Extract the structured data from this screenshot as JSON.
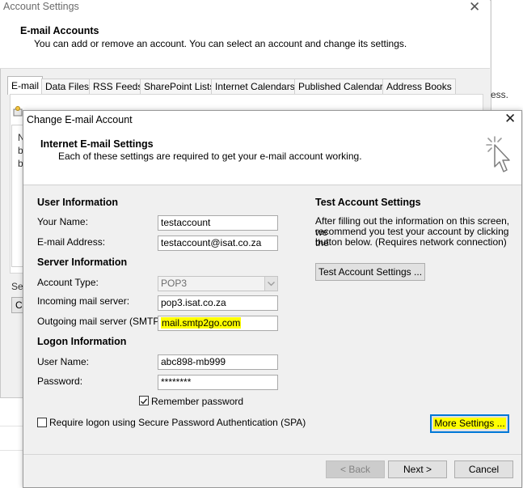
{
  "account_settings": {
    "title": "Account Settings",
    "header_title": "E-mail Accounts",
    "header_subtitle": "You can add or remove an account. You can select an account and change its settings.",
    "tabs": [
      {
        "label": "E-mail",
        "active": true
      },
      {
        "label": "Data Files"
      },
      {
        "label": "RSS Feeds"
      },
      {
        "label": "SharePoint Lists"
      },
      {
        "label": "Internet Calendars"
      },
      {
        "label": "Published Calendars"
      },
      {
        "label": "Address Books"
      }
    ],
    "list_letters": [
      "N",
      "b",
      "b"
    ],
    "partial_select_label": "Sel",
    "partial_button_label": "C",
    "behind_text": "ess."
  },
  "dialog": {
    "title": "Change E-mail Account",
    "header_title": "Internet E-mail Settings",
    "header_subtitle": "Each of these settings are required to get your e-mail account working.",
    "user_info": {
      "heading": "User Information",
      "your_name_label": "Your Name:",
      "your_name_value": "testaccount",
      "email_label": "E-mail Address:",
      "email_value": "testaccount@isat.co.za"
    },
    "server_info": {
      "heading": "Server Information",
      "account_type_label": "Account Type:",
      "account_type_value": "POP3",
      "incoming_label": "Incoming mail server:",
      "incoming_value": "pop3.isat.co.za",
      "outgoing_label": "Outgoing mail server (SMTP):",
      "outgoing_value": "mail.smtp2go.com"
    },
    "logon_info": {
      "heading": "Logon Information",
      "username_label": "User Name:",
      "username_value": "abc898-mb999",
      "password_label": "Password:",
      "password_value": "********",
      "remember_password_label": "Remember password",
      "remember_password_checked": true,
      "spa_label": "Require logon using Secure Password Authentication (SPA)",
      "spa_checked": false
    },
    "test_settings": {
      "heading": "Test Account Settings",
      "description_lines": [
        "After filling out the information on this screen, we",
        "recommend you test your account by clicking the",
        "button below. (Requires network connection)"
      ],
      "button_label": "Test Account Settings ..."
    },
    "more_settings_label": "More Settings ...",
    "back_label": "< Back",
    "next_label": "Next >",
    "cancel_label": "Cancel"
  },
  "colors": {
    "highlight": "#ffff00",
    "focus_border": "#0078d7"
  }
}
